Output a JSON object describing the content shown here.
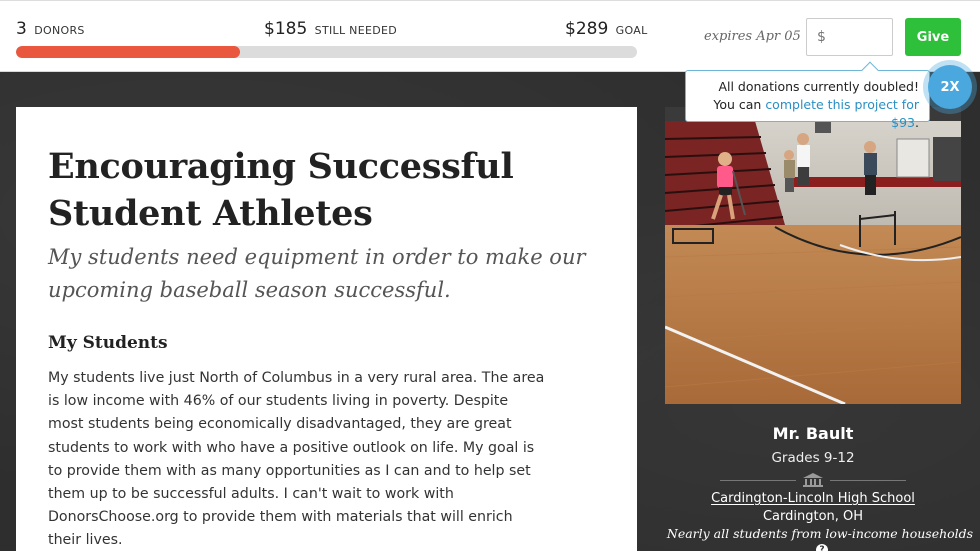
{
  "progress": {
    "donors_count": "3",
    "donors_label": "DONORS",
    "still_needed_amount": "$185",
    "still_needed_label": "STILL NEEDED",
    "goal_amount": "$289",
    "goal_label": "GOAL",
    "percent_funded": 36,
    "fill_color": "#e8573e"
  },
  "donate": {
    "expires": "expires Apr 05",
    "amount_placeholder": "$",
    "give_label": "Give",
    "give_color": "#2ec03a"
  },
  "match_tooltip": {
    "line1": "All donations currently doubled!",
    "line2_prefix": "You can ",
    "line2_link": "complete this project for $93",
    "line2_suffix": ".",
    "badge": "2X",
    "badge_color": "#4aa8de"
  },
  "project": {
    "title": "Encouraging Successful Student Athletes",
    "subtitle": "My students need equipment in order to make our upcoming baseball season successful.",
    "section_heading": "My Students",
    "body": "My students live just North of Columbus in a very rural area. The area is low income with 46% of our students living in poverty. Despite most students being economically disadvantaged, they are great students to work with who have a positive outlook on life. My goal is to provide them with as many opportunities as I can and to help set them up to be successful adults. I can't wait to work with DonorsChoose.org to provide them with materials that will enrich their lives."
  },
  "teacher": {
    "name": "Mr. Bault",
    "grades": "Grades 9-12",
    "school_icon": "school-building-icon",
    "school": "Cardington-Lincoln High School",
    "location": "Cardington, OH",
    "poverty_note": "Nearly all students from low-income households"
  }
}
